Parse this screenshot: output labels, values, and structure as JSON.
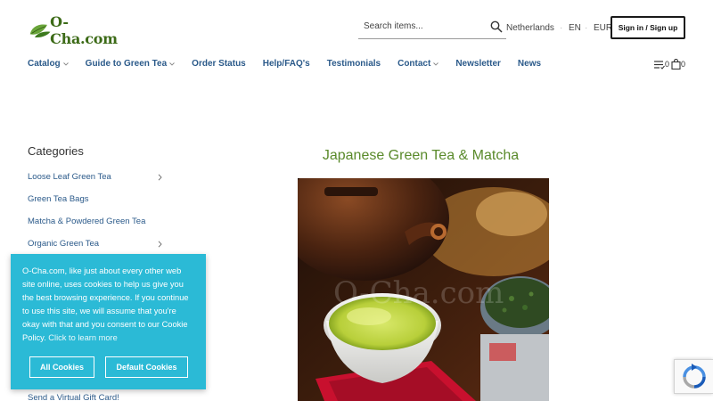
{
  "header": {
    "logo_text": "O-Cha.com",
    "search": {
      "placeholder": "Search items..."
    },
    "country": "Netherlands",
    "separator": "·",
    "language": "EN",
    "currency": "EUR",
    "signin_label": "Sign in / Sign up"
  },
  "nav": {
    "catalog": "Catalog",
    "guide": "Guide to Green Tea",
    "order_status": "Order Status",
    "help": "Help/FAQ's",
    "testimonials": "Testimonials",
    "contact": "Contact",
    "newsletter": "Newsletter",
    "news": "News",
    "list_count": "0",
    "cart_count": "0"
  },
  "sidebar": {
    "title": "Categories",
    "items": [
      {
        "label": "Loose Leaf Green Tea",
        "has_children": true
      },
      {
        "label": "Green Tea Bags",
        "has_children": false
      },
      {
        "label": "Matcha & Powdered Green Tea",
        "has_children": false
      },
      {
        "label": "Organic Green Tea",
        "has_children": true
      }
    ],
    "gift_card": "Send a Virtual Gift Card!"
  },
  "main": {
    "title": "Japanese Green Tea & Matcha",
    "watermark": "O-Cha.com"
  },
  "cookie": {
    "text": "O-Cha.com, like just about every other web site online, uses cookies to help us give you the best browsing experience. If you continue to use this site, we will assume that you're okay with that and you consent to our Cookie Policy.",
    "link": "Click to learn more",
    "btn_all": "All Cookies",
    "btn_default": "Default Cookies"
  },
  "colors": {
    "link_blue": "#2b5a8a",
    "title_green": "#5a8a2b",
    "cookie_bg": "#2bbad6"
  }
}
